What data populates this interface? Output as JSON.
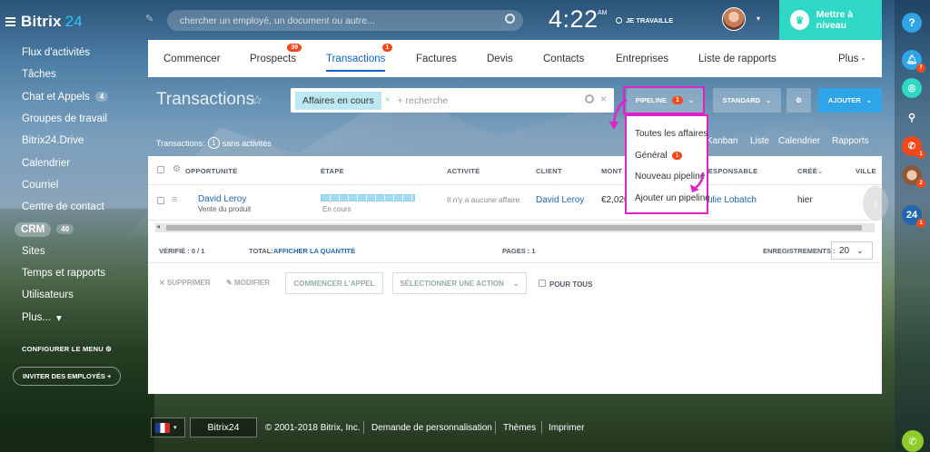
{
  "app": {
    "logo_main": "Bitrix",
    "logo_num": "24"
  },
  "sidebar": {
    "items": [
      {
        "label": "Flux d'activités"
      },
      {
        "label": "Tâches"
      },
      {
        "label": "Chat et Appels",
        "badge": "4"
      },
      {
        "label": "Groupes de travail"
      },
      {
        "label": "Bitrix24.Drive"
      },
      {
        "label": "Calendrier"
      },
      {
        "label": "Courriel"
      },
      {
        "label": "Centre de contact"
      },
      {
        "label": "CRM",
        "badge": "40"
      },
      {
        "label": "Sites"
      },
      {
        "label": "Temps et rapports"
      },
      {
        "label": "Utilisateurs"
      },
      {
        "label": "Plus..."
      }
    ],
    "configure": "CONFIGURER LE MENU",
    "invite": "INVITER DES EMPLOYÉS"
  },
  "topbar": {
    "search_placeholder": "chercher un employé, un document ou autre...",
    "time": "4:22",
    "ampm": "AM",
    "work_status": "JE TRAVAILLE",
    "upgrade": "Mettre à niveau"
  },
  "rightbar": {
    "help": "?",
    "notif_badge": "7",
    "call_badge": "1",
    "avatar_badge": "2",
    "b24_badge": "1"
  },
  "tabs": [
    {
      "label": "Commencer"
    },
    {
      "label": "Prospects",
      "badge": "39"
    },
    {
      "label": "Transactions",
      "badge": "1",
      "active": true
    },
    {
      "label": "Factures"
    },
    {
      "label": "Devis"
    },
    {
      "label": "Contacts"
    },
    {
      "label": "Entreprises"
    },
    {
      "label": "Liste de rapports"
    },
    {
      "label": "Plus -"
    }
  ],
  "toolbar": {
    "title": "Transactions",
    "filter_chip": "Affaires en cours",
    "filter_placeholder": "+ recherche",
    "pipeline_label": "PIPELINE",
    "pipeline_badge": "1",
    "standard_label": "STANDARD",
    "add_label": "AJOUTER"
  },
  "pipeline_menu": {
    "items": [
      {
        "label": "Toutes les affaires"
      },
      {
        "label": "Général",
        "badge": "1"
      },
      {
        "label": "Nouveau pipeline"
      },
      {
        "label": "Ajouter un pipeline"
      }
    ]
  },
  "summary": {
    "prefix": "Transactions:",
    "count": "1",
    "suffix": "sans activités"
  },
  "views": [
    "Kanban",
    "Liste",
    "Calendrier",
    "Rapports"
  ],
  "table": {
    "headers": [
      "OPPORTUNITÉ",
      "ÉTAPE",
      "ACTIVITÉ",
      "CLIENT",
      "MONT",
      "RESPONSABLE",
      "CRÉÉ",
      "VILLE"
    ],
    "rows": [
      {
        "opportunity": "David Leroy",
        "opportunity_sub": "Vente du produit",
        "stage": "En cours",
        "activity": "Il n'y a aucune affaire",
        "client": "David Leroy",
        "amount": "€2,020",
        "responsible": "Julie Lobatch",
        "created": "hier"
      }
    ]
  },
  "footer_bar": {
    "verified": "VÉRIFIÉ : 0 / 1",
    "total_label": "TOTAL:",
    "total_link": "AFFICHER LA QUANTITÉ",
    "pages": "PAGES : 1",
    "records_label": "ENREGISTREMENTS :",
    "records_value": "20"
  },
  "actions": {
    "delete": "SUPPRIMER",
    "edit": "MODIFIER",
    "start_call": "COMMENCER L'APPEL",
    "select_action": "SÉLECTIONNER UNE ACTION",
    "for_all": "POUR TOUS"
  },
  "page_footer": {
    "brand": "Bitrix24",
    "copyright": "© 2001-2018 Bitrix, Inc.",
    "customize": "Demande de personnalisation",
    "themes": "Thèmes",
    "print": "Imprimer"
  }
}
